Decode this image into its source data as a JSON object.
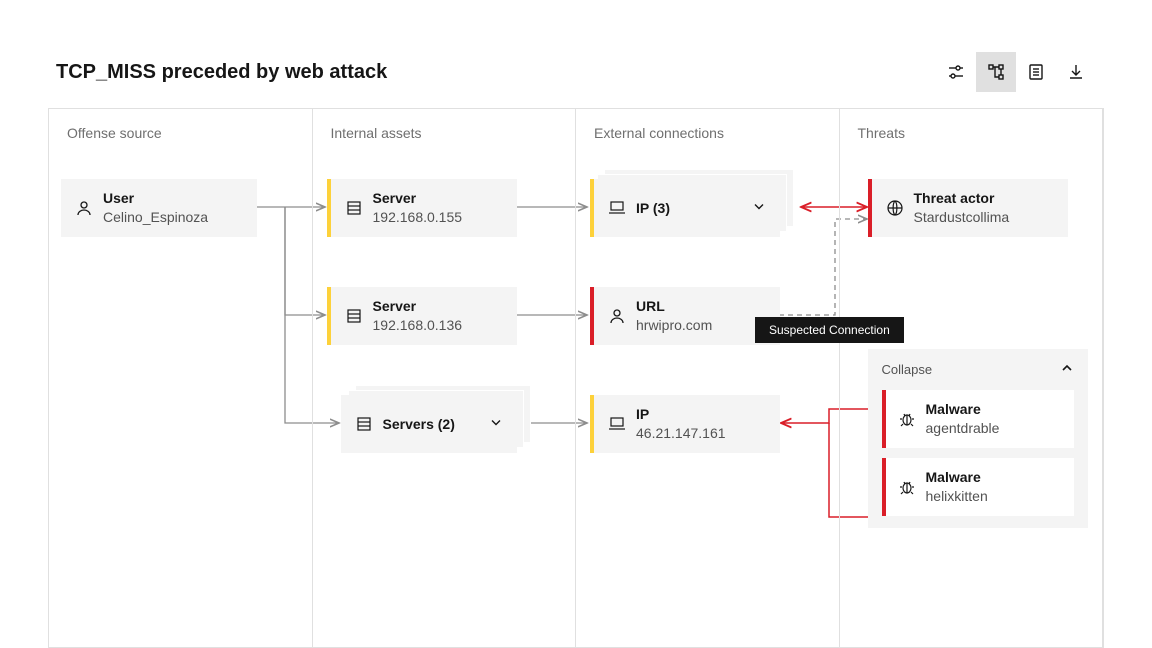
{
  "title": "TCP_MISS preceded by web attack",
  "columns": {
    "offense_source": "Offense source",
    "internal_assets": "Internal assets",
    "external_connections": "External connections",
    "threats": "Threats"
  },
  "nodes": {
    "user": {
      "type": "User",
      "value": "Celino_Espinoza"
    },
    "server1": {
      "type": "Server",
      "value": "192.168.0.155"
    },
    "server2": {
      "type": "Server",
      "value": "192.168.0.136"
    },
    "servers_group": {
      "type": "Servers (2)"
    },
    "ip_group": {
      "type": "IP (3)"
    },
    "url": {
      "type": "URL",
      "value": "hrwipro.com"
    },
    "ip": {
      "type": "IP",
      "value": "46.21.147.161"
    },
    "threat_actor": {
      "type": "Threat actor",
      "value": "Stardustcollima"
    },
    "malware1": {
      "type": "Malware",
      "value": "agentdrable"
    },
    "malware2": {
      "type": "Malware",
      "value": "helixkitten"
    }
  },
  "collapse_label": "Collapse",
  "tooltip": "Suspected Connection",
  "colors": {
    "gray_conn": "#8d8d8d",
    "red_conn": "#da1e28",
    "yellow": "#fdd13a"
  }
}
